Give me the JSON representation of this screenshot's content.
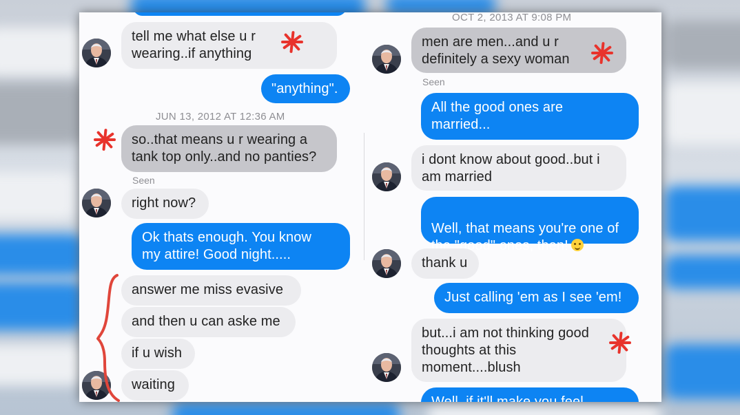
{
  "left": {
    "bubbles": [
      {
        "text": "",
        "kind": "out"
      },
      {
        "text": "tell me what else u r\nwearing..if anything",
        "kind": "in-light"
      },
      {
        "text": "\"anything\".",
        "kind": "out"
      },
      {
        "text": "so..that means u r wearing a\ntank top only..and no panties?",
        "kind": "in-dark"
      },
      {
        "text": "right now?",
        "kind": "in-light"
      },
      {
        "text": "Ok thats enough.  You know\nmy attire!  Good night.....",
        "kind": "out"
      },
      {
        "text": "answer me miss evasive",
        "kind": "in-light"
      },
      {
        "text": "and then u can aske me",
        "kind": "in-light"
      },
      {
        "text": "if u wish",
        "kind": "in-light"
      },
      {
        "text": "waiting",
        "kind": "in-light"
      }
    ],
    "timestamp": "JUN 13, 2012 AT 12:36 AM",
    "seen": "Seen"
  },
  "right": {
    "timestamp": "OCT 2, 2013 AT 9:08 PM",
    "seen": "Seen",
    "bubbles": [
      {
        "text": "men are men...and u r\ndefinitely a sexy woman",
        "kind": "in-dark"
      },
      {
        "text": "All the good ones are\nmarried...",
        "kind": "out"
      },
      {
        "text": "i dont know about good..but i\nam married",
        "kind": "in-light"
      },
      {
        "text": "Well, that means you're one of\nthe \"good\" ones, then!",
        "kind": "out",
        "emoji": "smiley-emoji"
      },
      {
        "text": "thank u",
        "kind": "in-light"
      },
      {
        "text": "Just calling 'em as I see 'em!",
        "kind": "out"
      },
      {
        "text": "but...i am not thinking good\nthoughts at this\nmoment....blush",
        "kind": "in-light"
      },
      {
        "text": "Well, if it'll make you feel",
        "kind": "out"
      }
    ]
  },
  "annotations": {
    "star_color": "#e8332c",
    "brace_color": "#e0463b"
  },
  "colors": {
    "outgoing": "#0d84f3",
    "incoming_light": "#ececef",
    "incoming_dark": "#c6c6cb"
  }
}
